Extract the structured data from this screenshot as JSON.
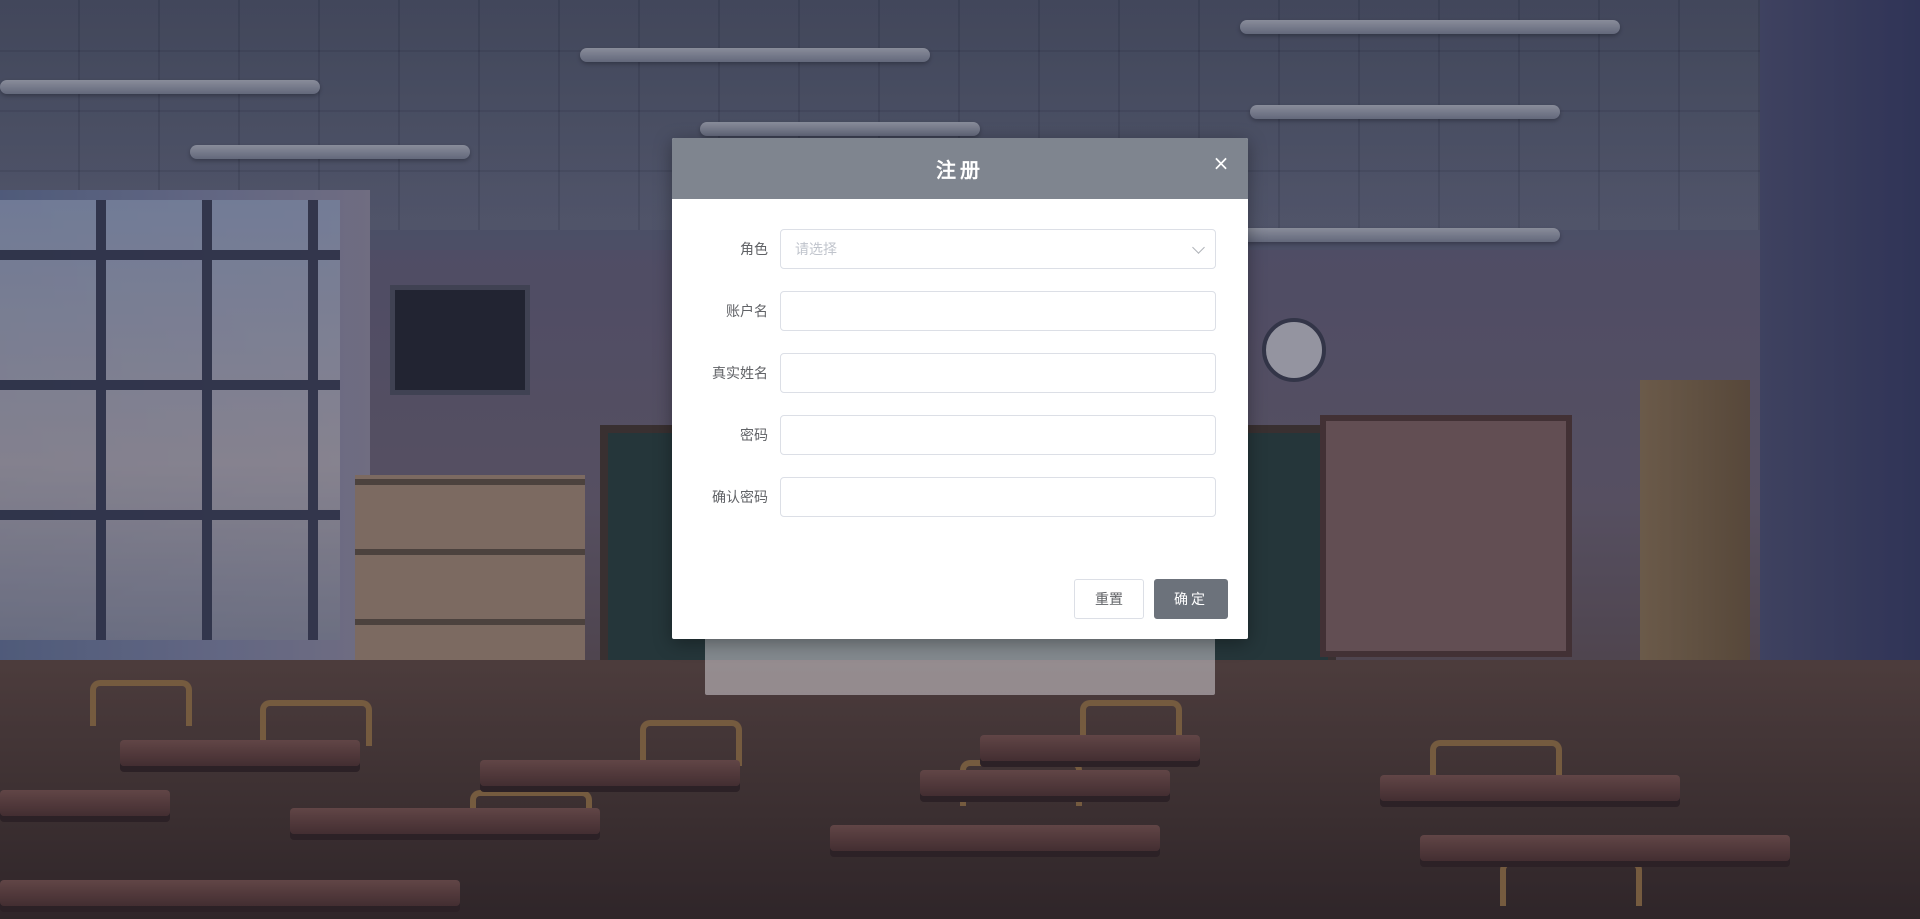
{
  "dialog": {
    "title": "注册",
    "close_icon": "×"
  },
  "form": {
    "role": {
      "label": "角色",
      "placeholder": "请选择"
    },
    "account": {
      "label": "账户名",
      "value": ""
    },
    "real_name": {
      "label": "真实姓名",
      "value": ""
    },
    "password": {
      "label": "密码",
      "value": ""
    },
    "confirm_password": {
      "label": "确认密码",
      "value": ""
    }
  },
  "buttons": {
    "reset": "重置",
    "confirm": "确定"
  },
  "colors": {
    "header": "#7f858f",
    "confirm_button": "#6c727b"
  }
}
